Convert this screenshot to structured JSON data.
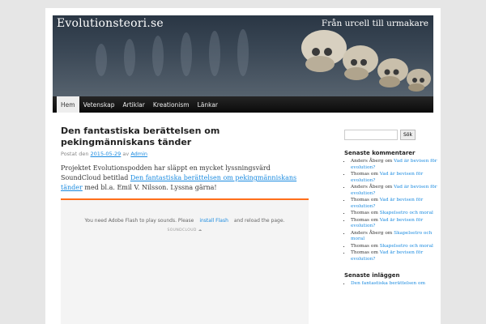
{
  "site": {
    "title": "Evolutionsteori.se",
    "description": "Från urcell till urmakare"
  },
  "nav": [
    {
      "label": "Hem",
      "active": true
    },
    {
      "label": "Vetenskap"
    },
    {
      "label": "Artiklar"
    },
    {
      "label": "Kreationism"
    },
    {
      "label": "Länkar"
    }
  ],
  "post": {
    "title": "Den fantastiska berättelsen om pekingmänniskans tänder",
    "meta_prefix": "Postat den",
    "date": "2015-05-29",
    "meta_by": "av",
    "author": "Admin",
    "body_part1": "Projektet Evolutionspodden har släppt en mycket lyssningsvärd SoundCloud betitlad",
    "body_link": "Den fantastiska berättelsen om pekingmänniskans tänder",
    "body_part2": "med bl.a. Emil V. Nilsson. Lyssna gärna!"
  },
  "player": {
    "message_before": "You need Adobe Flash to play sounds. Please",
    "install_link": "install Flash",
    "message_after": "and reload the page.",
    "brand": "SOUNDCLOUD"
  },
  "sidebar": {
    "search_button": "Sök",
    "comments_title": "Senaste kommentarer",
    "comments": [
      {
        "author": "Anders Åberg",
        "on": "om",
        "post": "Vad är bevisen för evolution?"
      },
      {
        "author": "Thomas",
        "on": "om",
        "post": "Vad är bevisen för evolution?"
      },
      {
        "author": "Anders Åberg",
        "on": "om",
        "post": "Vad är bevisen för evolution?"
      },
      {
        "author": "Thomas",
        "on": "om",
        "post": "Vad är bevisen för evolution?"
      },
      {
        "author": "Thomas",
        "on": "om",
        "post": "Skapelsetro och moral"
      },
      {
        "author": "Thomas",
        "on": "om",
        "post": "Vad är bevisen för evolution?"
      },
      {
        "author": "Anders Åberg",
        "on": "om",
        "post": "Skapelsetro och moral"
      },
      {
        "author": "Thomas",
        "on": "om",
        "post": "Skapelsetro och moral"
      },
      {
        "author": "Thomas",
        "on": "om",
        "post": "Vad är bevisen för evolution?"
      }
    ],
    "recent_title": "Senaste inläggen",
    "recent": [
      "Den fantastiska berättelsen om"
    ]
  },
  "colors": {
    "link": "#1b8be0",
    "player_accent": "#ff6e1a",
    "nav_background": "#111111"
  }
}
